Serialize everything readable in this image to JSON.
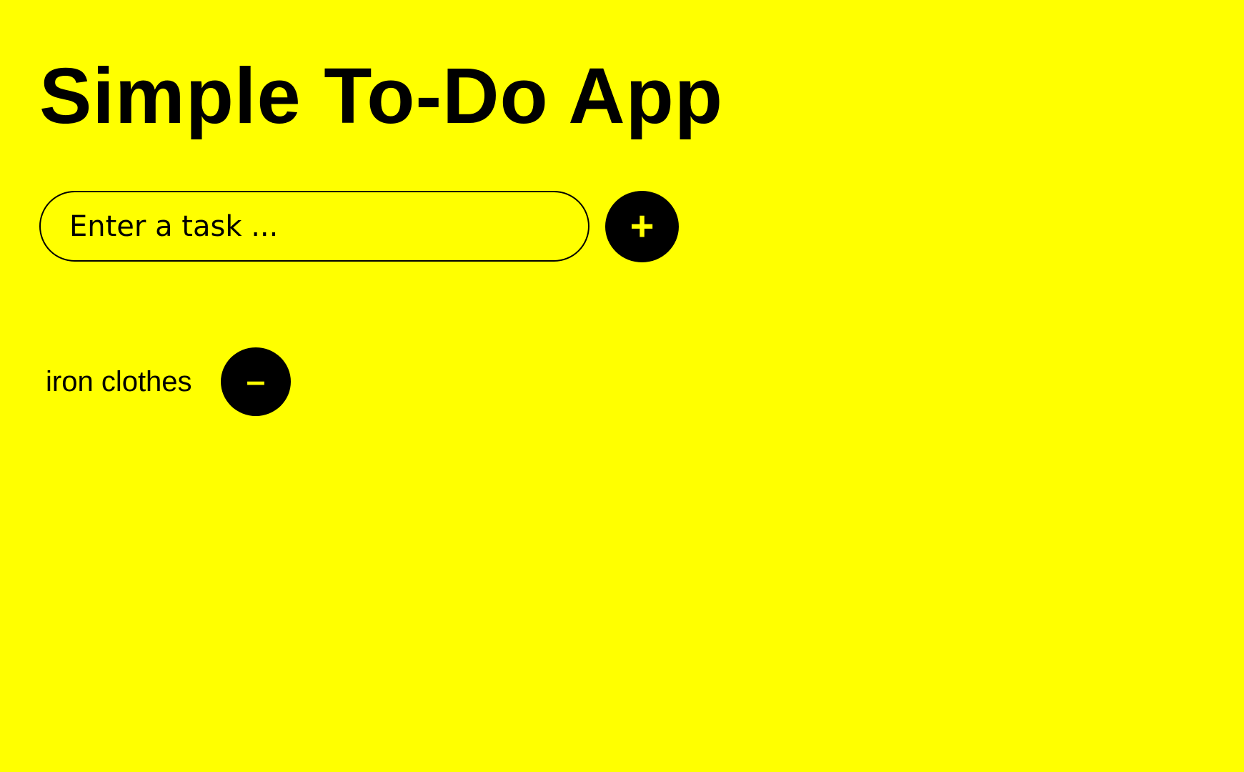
{
  "app": {
    "title": "Simple To-Do App"
  },
  "input": {
    "placeholder": "Enter a task ...",
    "value": ""
  },
  "add_button": {
    "label": "+"
  },
  "tasks": [
    {
      "text": "iron clothes",
      "remove_label": "–"
    }
  ],
  "colors": {
    "background": "#ffff00",
    "foreground": "#000000",
    "button_text": "#ffff00"
  }
}
